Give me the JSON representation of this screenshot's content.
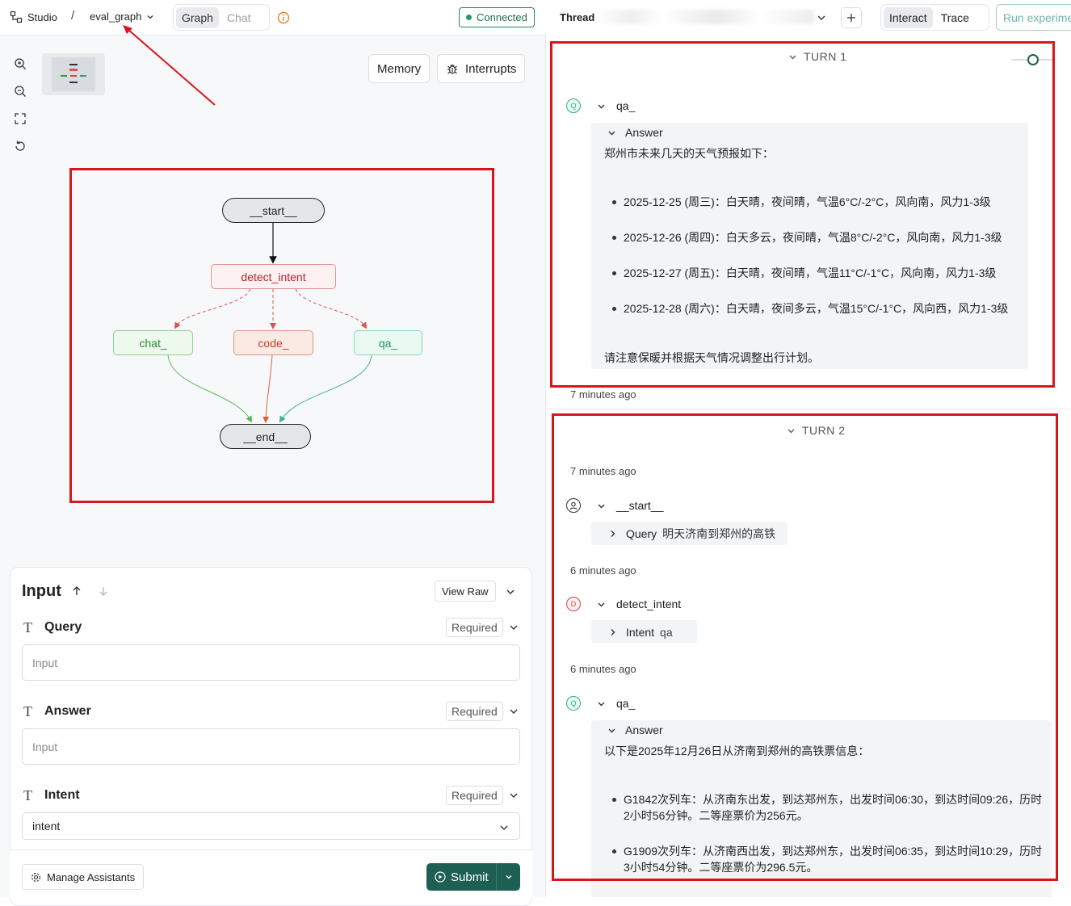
{
  "header": {
    "brand": "Studio",
    "separator": "/",
    "graph_name": "eval_graph",
    "tab_graph": "Graph",
    "tab_chat": "Chat",
    "status": "Connected"
  },
  "canvas": {
    "memory_label": "Memory",
    "interrupts_label": "Interrupts",
    "nodes": {
      "start": "__start__",
      "detect": "detect_intent",
      "chat": "chat_",
      "code": "code_",
      "qa": "qa_",
      "end": "__end__"
    }
  },
  "input_panel": {
    "title": "Input",
    "view_raw": "View Raw",
    "fields": [
      {
        "label": "Query",
        "required": "Required",
        "placeholder": "Input"
      },
      {
        "label": "Answer",
        "required": "Required",
        "placeholder": "Input"
      },
      {
        "label": "Intent",
        "required": "Required",
        "value": "intent"
      }
    ],
    "manage": "Manage Assistants",
    "submit": "Submit"
  },
  "thread": {
    "label": "Thread",
    "interact": "Interact",
    "trace": "Trace",
    "run": "Run experime"
  },
  "turn1": {
    "title": "TURN 1",
    "node": "qa_",
    "node_initial": "Q",
    "answer_label": "Answer",
    "intro": "郑州市未来几天的天气预报如下：",
    "items": [
      "2025-12-25 (周三)：白天晴，夜间晴，气温6°C/-2°C，风向南，风力1-3级",
      "2025-12-26 (周四)：白天多云，夜间晴，气温8°C/-2°C，风向南，风力1-3级",
      "2025-12-27 (周五)：白天晴，夜间晴，气温11°C/-1°C，风向南，风力1-3级",
      "2025-12-28 (周六)：白天晴，夜间多云，气温15°C/-1°C，风向西，风力1-3级"
    ],
    "outro": "请注意保暖并根据天气情况调整出行计划。",
    "time": "7 minutes ago"
  },
  "turn2": {
    "title": "TURN 2",
    "time1": "7 minutes ago",
    "start_node": "__start__",
    "query_label": "Query",
    "query_value": "明天济南到郑州的高铁",
    "time2": "6 minutes ago",
    "detect_node": "detect_intent",
    "detect_initial": "D",
    "intent_label": "Intent",
    "intent_value": "qa",
    "time3": "6 minutes ago",
    "qa_node": "qa_",
    "qa_initial": "Q",
    "answer_label": "Answer",
    "intro": "以下是2025年12月26日从济南到郑州的高铁票信息：",
    "items": [
      "G1842次列车：从济南东出发，到达郑州东，出发时间06:30，到达时间09:26，历时2小时56分钟。二等座票价为256元。",
      "G1909次列车：从济南西出发，到达郑州东，出发时间06:35，到达时间10:29，历时3小时54分钟。二等座票价为296.5元。"
    ]
  },
  "colors": {
    "annotation_red": "#d9141b",
    "connected_green": "#1f8a5b",
    "submit_bg": "#1e5f54",
    "node_red": "#c8323a",
    "node_green": "#3a9a3a",
    "node_teal": "#2f9e7a",
    "node_orange": "#c8503a"
  }
}
